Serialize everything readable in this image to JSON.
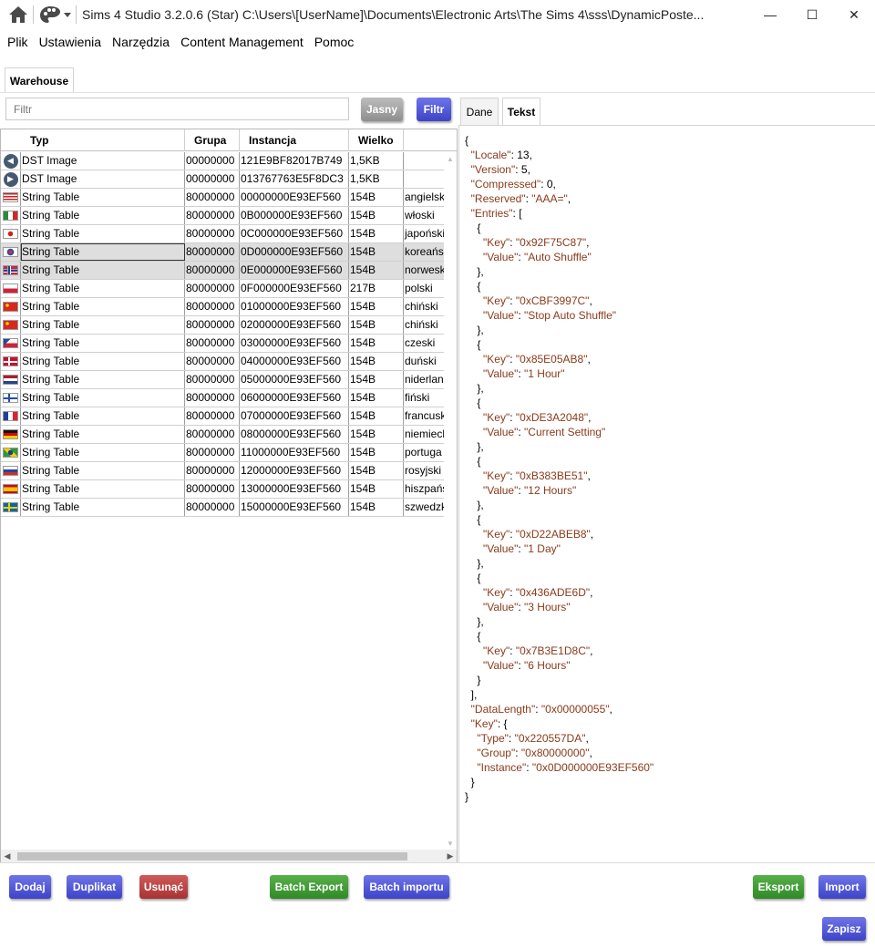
{
  "window": {
    "title": "Sims 4 Studio 3.2.0.6 (Star)  C:\\Users\\[UserName]\\Documents\\Electronic Arts\\The Sims 4\\sss\\DynamicPoste...",
    "minimize": "—",
    "maximize": "☐",
    "close": "✕"
  },
  "menu": [
    "Plik",
    "Ustawienia",
    "Narzędzia",
    "Content Management",
    "Pomoc"
  ],
  "warehouse_tab": "Warehouse",
  "filter": {
    "placeholder": "Filtr",
    "clear_label": "Jasny",
    "filter_label": "Filtr"
  },
  "grid": {
    "columns": [
      "Typ",
      "Grupa",
      "Instancja",
      "Wielko"
    ],
    "rows": [
      {
        "icon": "dst",
        "type": "DST Image",
        "group": "00000000",
        "instance": "121E9BF82017B749",
        "size": "1,5KB",
        "lang": ""
      },
      {
        "icon": "dst",
        "type": "DST Image",
        "group": "00000000",
        "instance": "013767763E5F8DC3",
        "size": "1,5KB",
        "lang": ""
      },
      {
        "icon": "us",
        "type": "String Table",
        "group": "80000000",
        "instance": "00000000E93EF560",
        "size": "154B",
        "lang": "angielsk"
      },
      {
        "icon": "it",
        "type": "String Table",
        "group": "80000000",
        "instance": "0B000000E93EF560",
        "size": "154B",
        "lang": "włoski"
      },
      {
        "icon": "jp",
        "type": "String Table",
        "group": "80000000",
        "instance": "0C000000E93EF560",
        "size": "154B",
        "lang": "japoński"
      },
      {
        "icon": "kr",
        "type": "String Table",
        "group": "80000000",
        "instance": "0D000000E93EF560",
        "size": "154B",
        "lang": "koreańsk"
      },
      {
        "icon": "no",
        "type": "String Table",
        "group": "80000000",
        "instance": "0E000000E93EF560",
        "size": "154B",
        "lang": "norwesk"
      },
      {
        "icon": "pl",
        "type": "String Table",
        "group": "80000000",
        "instance": "0F000000E93EF560",
        "size": "217B",
        "lang": "polski"
      },
      {
        "icon": "cn",
        "type": "String Table",
        "group": "80000000",
        "instance": "01000000E93EF560",
        "size": "154B",
        "lang": "chiński"
      },
      {
        "icon": "cn",
        "type": "String Table",
        "group": "80000000",
        "instance": "02000000E93EF560",
        "size": "154B",
        "lang": "chiński"
      },
      {
        "icon": "cz",
        "type": "String Table",
        "group": "80000000",
        "instance": "03000000E93EF560",
        "size": "154B",
        "lang": "czeski"
      },
      {
        "icon": "dk",
        "type": "String Table",
        "group": "80000000",
        "instance": "04000000E93EF560",
        "size": "154B",
        "lang": "duński"
      },
      {
        "icon": "nl",
        "type": "String Table",
        "group": "80000000",
        "instance": "05000000E93EF560",
        "size": "154B",
        "lang": "niderlan"
      },
      {
        "icon": "fi",
        "type": "String Table",
        "group": "80000000",
        "instance": "06000000E93EF560",
        "size": "154B",
        "lang": "fiński"
      },
      {
        "icon": "fr",
        "type": "String Table",
        "group": "80000000",
        "instance": "07000000E93EF560",
        "size": "154B",
        "lang": "francusk"
      },
      {
        "icon": "de",
        "type": "String Table",
        "group": "80000000",
        "instance": "08000000E93EF560",
        "size": "154B",
        "lang": "niemiecl"
      },
      {
        "icon": "br",
        "type": "String Table",
        "group": "80000000",
        "instance": "11000000E93EF560",
        "size": "154B",
        "lang": "portuga"
      },
      {
        "icon": "ru",
        "type": "String Table",
        "group": "80000000",
        "instance": "12000000E93EF560",
        "size": "154B",
        "lang": "rosyjski"
      },
      {
        "icon": "es",
        "type": "String Table",
        "group": "80000000",
        "instance": "13000000E93EF560",
        "size": "154B",
        "lang": "hiszpańs"
      },
      {
        "icon": "se",
        "type": "String Table",
        "group": "80000000",
        "instance": "15000000E93EF560",
        "size": "154B",
        "lang": "szwedzk"
      }
    ]
  },
  "right_tabs": [
    "Dane",
    "Tekst"
  ],
  "json_text": [
    "{",
    "  \"Locale\": 13,",
    "  \"Version\": 5,",
    "  \"Compressed\": 0,",
    "  \"Reserved\": \"AAA=\",",
    "  \"Entries\": [",
    "    {",
    "      \"Key\": \"0x92F75C87\",",
    "      \"Value\": \"Auto Shuffle\"",
    "    },",
    "    {",
    "      \"Key\": \"0xCBF3997C\",",
    "      \"Value\": \"Stop Auto Shuffle\"",
    "    },",
    "    {",
    "      \"Key\": \"0x85E05AB8\",",
    "      \"Value\": \"1 Hour\"",
    "    },",
    "    {",
    "      \"Key\": \"0xDE3A2048\",",
    "      \"Value\": \"Current Setting\"",
    "    },",
    "    {",
    "      \"Key\": \"0xB383BE51\",",
    "      \"Value\": \"12 Hours\"",
    "    },",
    "    {",
    "      \"Key\": \"0xD22ABEB8\",",
    "      \"Value\": \"1 Day\"",
    "    },",
    "    {",
    "      \"Key\": \"0x436ADE6D\",",
    "      \"Value\": \"3 Hours\"",
    "    },",
    "    {",
    "      \"Key\": \"0x7B3E1D8C\",",
    "      \"Value\": \"6 Hours\"",
    "    }",
    "  ],",
    "  \"DataLength\": \"0x00000055\",",
    "  \"Key\": {",
    "    \"Type\": \"0x220557DA\",",
    "    \"Group\": \"0x80000000\",",
    "    \"Instance\": \"0x0D000000E93EF560\"",
    "  }",
    "}"
  ],
  "buttons": {
    "add": "Dodaj",
    "duplicate": "Duplikat",
    "delete": "Usunąć",
    "batch_export": "Batch Export",
    "batch_import": "Batch importu",
    "export": "Eksport",
    "import": "Import",
    "save": "Zapisz"
  },
  "colors": {
    "blue_button": "#4a51d6",
    "red_button": "#b94444",
    "green_button": "#3c9a32",
    "json_string": "#8a3a1b",
    "selected_row": "#dedede"
  }
}
